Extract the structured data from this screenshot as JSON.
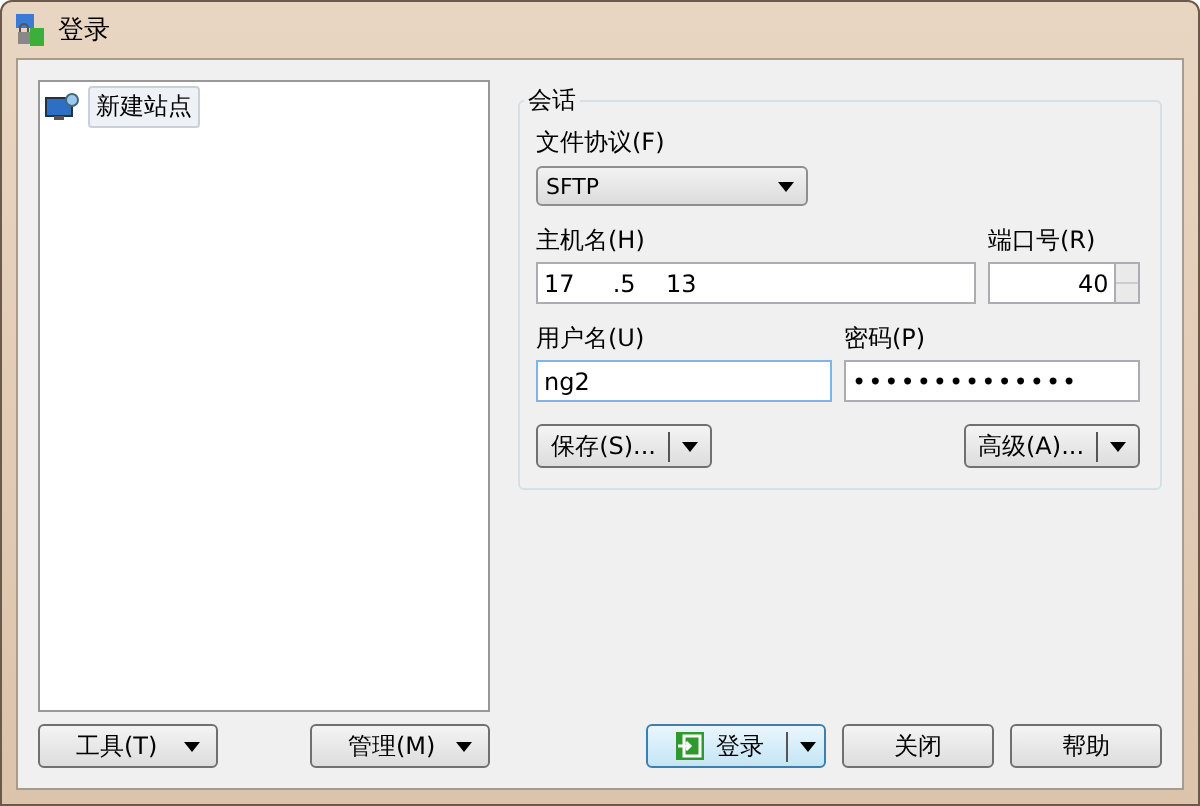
{
  "window": {
    "title": "登录"
  },
  "sites": [
    {
      "label": "新建站点",
      "selected": true
    }
  ],
  "session": {
    "title": "会话",
    "protocol": {
      "label": "文件协议(F)",
      "value": "SFTP"
    },
    "host": {
      "label": "主机名(H)",
      "value": "17     .5    13"
    },
    "port": {
      "label": "端口号(R)",
      "value": "40"
    },
    "user": {
      "label": "用户名(U)",
      "value": "ng2"
    },
    "password": {
      "label": "密码(P)",
      "value": "••••••••••••••"
    },
    "save_button": "保存(S)...",
    "advanced_button": "高级(A)..."
  },
  "left_buttons": [
    "工具(T)",
    "管理(M)"
  ],
  "login_button": "登录",
  "buttons": [
    "关闭",
    "帮助"
  ]
}
